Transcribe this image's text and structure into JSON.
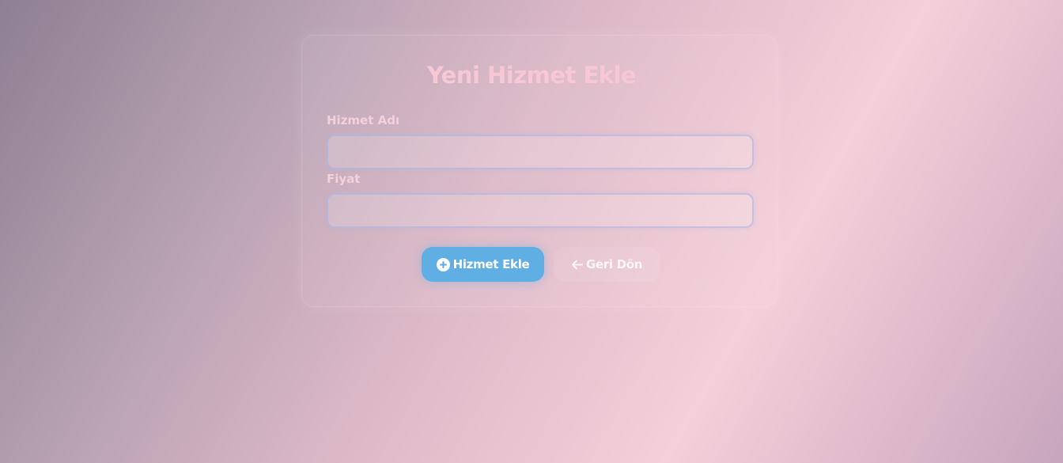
{
  "form": {
    "title": "Yeni Hizmet Ekle",
    "fields": [
      {
        "label": "Hizmet Adı",
        "value": "",
        "placeholder": ""
      },
      {
        "label": "Fiyat",
        "value": "",
        "placeholder": ""
      }
    ],
    "buttons": {
      "submit": {
        "label": "Hizmet Ekle",
        "icon": "plus-circle-icon",
        "color": "#5fafe4"
      },
      "back": {
        "label": "Geri Dön",
        "icon": "arrow-left-icon"
      }
    }
  }
}
